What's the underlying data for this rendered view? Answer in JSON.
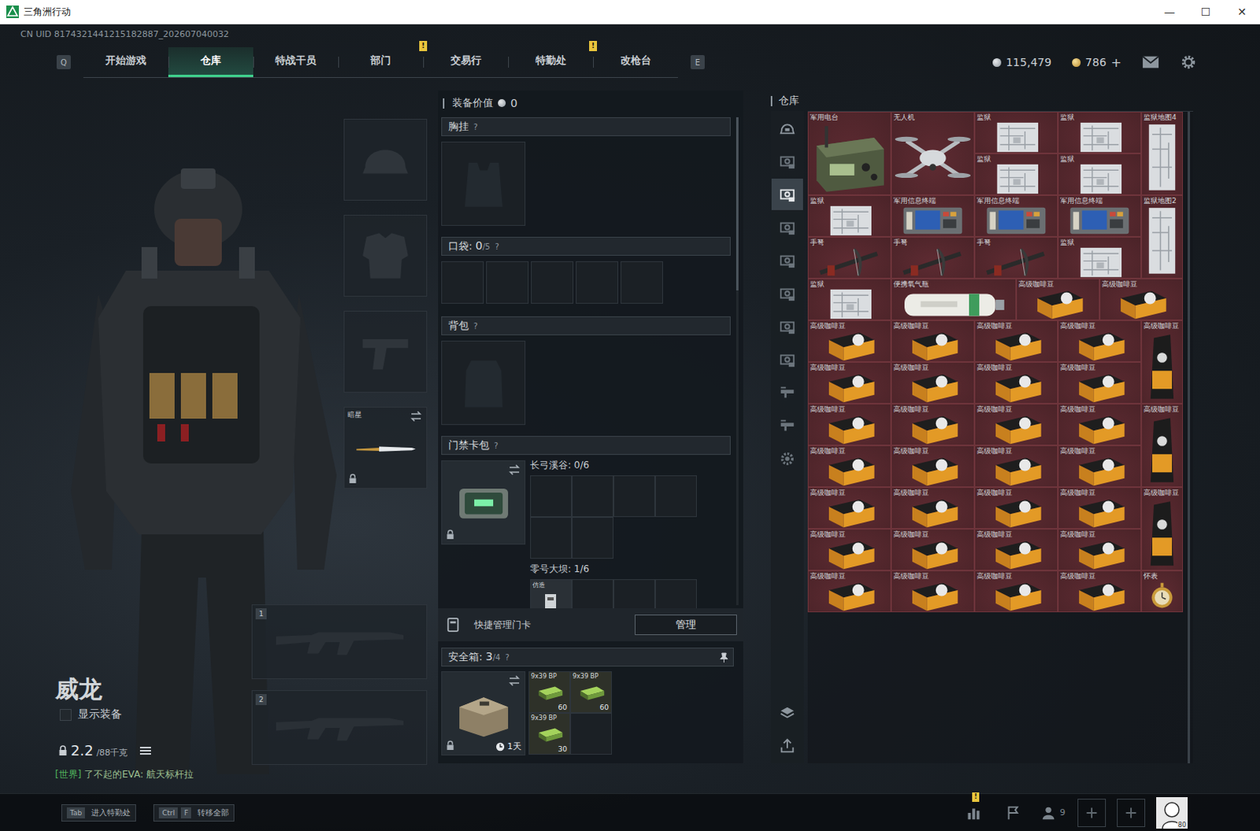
{
  "window": {
    "title": "三角洲行动",
    "controls": [
      "—",
      "☐",
      "✕"
    ]
  },
  "uid": "CN UID 8174321441215182887_202607040032",
  "nav": {
    "prev_key": "Q",
    "next_key": "E",
    "tabs": [
      {
        "label": "开始游戏",
        "selected": false,
        "badge": ""
      },
      {
        "label": "仓库",
        "selected": true,
        "badge": ""
      },
      {
        "label": "特战干员",
        "selected": false,
        "badge": ""
      },
      {
        "label": "部门",
        "selected": false,
        "badge": "!"
      },
      {
        "label": "交易行",
        "selected": false,
        "badge": ""
      },
      {
        "label": "特勤处",
        "selected": false,
        "badge": "!"
      },
      {
        "label": "改枪台",
        "selected": false,
        "badge": ""
      }
    ]
  },
  "wallet": [
    {
      "kind": "coin",
      "value": "115,479",
      "action": ""
    },
    {
      "kind": "gold",
      "value": "786",
      "action": "+"
    }
  ],
  "character": {
    "name": "威龙",
    "show_equipment": {
      "label": "显示装备",
      "checked": false
    },
    "weight": {
      "current": "2.2",
      "max": "/88千克"
    },
    "chat": {
      "channel": "[世界]",
      "message": "了不起的EVA: 航天标杆拉"
    }
  },
  "gear_slots": [
    {
      "kind": "helmet",
      "label": "",
      "locked": false,
      "swappable": false
    },
    {
      "kind": "armor",
      "label": "",
      "locked": false,
      "swappable": false
    },
    {
      "kind": "pistol",
      "label": "",
      "locked": false,
      "swappable": false
    },
    {
      "kind": "melee",
      "label": "暗星",
      "locked": true,
      "swappable": true
    }
  ],
  "weapon_slots": [
    {
      "index": "1"
    },
    {
      "index": "2"
    }
  ],
  "loadout": {
    "value_label": "装备价值",
    "value": "0",
    "chest_rig": {
      "label": "胸挂",
      "help": "?"
    },
    "pockets": {
      "label": "口袋:",
      "used": "0",
      "capacity": "/5",
      "help": "?",
      "slots": [
        {
          "filled": false
        },
        {
          "filled": false
        },
        {
          "filled": false
        },
        {
          "filled": false
        },
        {
          "filled": false
        }
      ]
    },
    "backpack": {
      "label": "背包",
      "help": "?"
    },
    "keycard": {
      "label": "门禁卡包",
      "help": "?",
      "locked": true,
      "swappable": true,
      "maps": [
        {
          "label": "长弓溪谷: 0/6",
          "cells": [
            {
              "item": ""
            },
            {
              "item": ""
            },
            {
              "item": ""
            },
            {
              "item": ""
            },
            {
              "item": ""
            },
            {
              "item": ""
            }
          ]
        },
        {
          "label": "零号大坝: 1/6",
          "cells": [
            {
              "item": "仿造"
            },
            {
              "item": ""
            },
            {
              "item": ""
            },
            {
              "item": ""
            },
            {
              "item": ""
            },
            {
              "item": ""
            }
          ]
        }
      ]
    },
    "quick_manage": {
      "label": "快捷管理门卡",
      "button": "管理"
    },
    "safe_box": {
      "label": "安全箱:",
      "used": "3",
      "capacity": "/4",
      "help": "?",
      "timer": "1天",
      "locked": true,
      "swappable": true,
      "items": [
        {
          "filled": true,
          "label": "9x39 BP",
          "count": "60"
        },
        {
          "filled": true,
          "label": "9x39 BP",
          "count": "60"
        },
        {
          "filled": true,
          "label": "9x39 BP",
          "count": "30"
        },
        {
          "filled": false,
          "label": "",
          "count": ""
        }
      ]
    }
  },
  "warehouse": {
    "title": "仓库",
    "sidebar": [
      {
        "kind": "all",
        "selected": false
      },
      {
        "kind": "stash",
        "selected": false
      },
      {
        "kind": "stash",
        "selected": true
      },
      {
        "kind": "stash",
        "selected": false
      },
      {
        "kind": "stash",
        "selected": false
      },
      {
        "kind": "stash",
        "selected": false
      },
      {
        "kind": "stash",
        "selected": false
      },
      {
        "kind": "stash",
        "selected": false
      },
      {
        "kind": "gti",
        "selected": false
      },
      {
        "kind": "gti",
        "selected": false
      },
      {
        "kind": "settings",
        "selected": false
      }
    ],
    "tools": [
      {
        "kind": "layers"
      },
      {
        "kind": "sort"
      }
    ],
    "items": [
      {
        "name": "军用电台",
        "kind": "radio",
        "w": 2,
        "h": 2
      },
      {
        "name": "无人机",
        "kind": "drone",
        "w": 2,
        "h": 2
      },
      {
        "name": "监狱",
        "kind": "map",
        "w": 2,
        "h": 1
      },
      {
        "name": "监狱",
        "kind": "map",
        "w": 2,
        "h": 1
      },
      {
        "name": "监狱地图4",
        "kind": "map-tall",
        "w": 1,
        "h": 2
      },
      {
        "name": "监狱",
        "kind": "map",
        "w": 2,
        "h": 1
      },
      {
        "name": "监狱",
        "kind": "map",
        "w": 2,
        "h": 1
      },
      {
        "name": "监狱",
        "kind": "map",
        "w": 2,
        "h": 1
      },
      {
        "name": "军用信息终端",
        "kind": "terminal",
        "w": 2,
        "h": 1
      },
      {
        "name": "军用信息终端",
        "kind": "terminal",
        "w": 2,
        "h": 1
      },
      {
        "name": "军用信息终端",
        "kind": "terminal",
        "w": 2,
        "h": 1
      },
      {
        "name": "监狱地图2",
        "kind": "map-tall",
        "w": 1,
        "h": 2
      },
      {
        "name": "手弩",
        "kind": "crossbow",
        "w": 2,
        "h": 1
      },
      {
        "name": "手弩",
        "kind": "crossbow",
        "w": 2,
        "h": 1
      },
      {
        "name": "手弩",
        "kind": "crossbow",
        "w": 2,
        "h": 1
      },
      {
        "name": "监狱",
        "kind": "map",
        "w": 2,
        "h": 1
      },
      {
        "name": "监狱",
        "kind": "map",
        "w": 2,
        "h": 1
      },
      {
        "name": "便携氧气瓶",
        "kind": "oxygen",
        "w": 3,
        "h": 1
      },
      {
        "name": "高级咖啡豆",
        "kind": "coffee",
        "w": 2,
        "h": 1
      },
      {
        "name": "高级咖啡豆",
        "kind": "coffee",
        "w": 2,
        "h": 1
      },
      {
        "name": "高级咖啡豆",
        "kind": "coffee",
        "w": 2,
        "h": 1
      },
      {
        "name": "高级咖啡豆",
        "kind": "coffee",
        "w": 2,
        "h": 1
      },
      {
        "name": "高级咖啡豆",
        "kind": "coffee",
        "w": 2,
        "h": 1
      },
      {
        "name": "高级咖啡豆",
        "kind": "coffee",
        "w": 2,
        "h": 1
      },
      {
        "name": "高级咖啡豆",
        "kind": "coffee-bag",
        "w": 1,
        "h": 2
      },
      {
        "name": "高级咖啡豆",
        "kind": "coffee",
        "w": 2,
        "h": 1
      },
      {
        "name": "高级咖啡豆",
        "kind": "coffee",
        "w": 2,
        "h": 1
      },
      {
        "name": "高级咖啡豆",
        "kind": "coffee",
        "w": 2,
        "h": 1
      },
      {
        "name": "高级咖啡豆",
        "kind": "coffee",
        "w": 2,
        "h": 1
      },
      {
        "name": "高级咖啡豆",
        "kind": "coffee",
        "w": 2,
        "h": 1
      },
      {
        "name": "高级咖啡豆",
        "kind": "coffee",
        "w": 2,
        "h": 1
      },
      {
        "name": "高级咖啡豆",
        "kind": "coffee",
        "w": 2,
        "h": 1
      },
      {
        "name": "高级咖啡豆",
        "kind": "coffee",
        "w": 2,
        "h": 1
      },
      {
        "name": "高级咖啡豆",
        "kind": "coffee-bag",
        "w": 1,
        "h": 2
      },
      {
        "name": "高级咖啡豆",
        "kind": "coffee",
        "w": 2,
        "h": 1
      },
      {
        "name": "高级咖啡豆",
        "kind": "coffee",
        "w": 2,
        "h": 1
      },
      {
        "name": "高级咖啡豆",
        "kind": "coffee",
        "w": 2,
        "h": 1
      },
      {
        "name": "高级咖啡豆",
        "kind": "coffee",
        "w": 2,
        "h": 1
      },
      {
        "name": "高级咖啡豆",
        "kind": "coffee",
        "w": 2,
        "h": 1
      },
      {
        "name": "高级咖啡豆",
        "kind": "coffee",
        "w": 2,
        "h": 1
      },
      {
        "name": "高级咖啡豆",
        "kind": "coffee",
        "w": 2,
        "h": 1
      },
      {
        "name": "高级咖啡豆",
        "kind": "coffee",
        "w": 2,
        "h": 1
      },
      {
        "name": "高级咖啡豆",
        "kind": "coffee-bag",
        "w": 1,
        "h": 2
      },
      {
        "name": "高级咖啡豆",
        "kind": "coffee",
        "w": 2,
        "h": 1
      },
      {
        "name": "高级咖啡豆",
        "kind": "coffee",
        "w": 2,
        "h": 1
      },
      {
        "name": "高级咖啡豆",
        "kind": "coffee",
        "w": 2,
        "h": 1
      },
      {
        "name": "高级咖啡豆",
        "kind": "coffee",
        "w": 2,
        "h": 1
      },
      {
        "name": "高级咖啡豆",
        "kind": "coffee",
        "w": 2,
        "h": 1
      },
      {
        "name": "高级咖啡豆",
        "kind": "coffee",
        "w": 2,
        "h": 1
      },
      {
        "name": "高级咖啡豆",
        "kind": "coffee",
        "w": 2,
        "h": 1
      },
      {
        "name": "高级咖啡豆",
        "kind": "coffee",
        "w": 2,
        "h": 1
      },
      {
        "name": "怀表",
        "kind": "watch",
        "w": 1,
        "h": 1
      }
    ]
  },
  "bottom": {
    "hints": [
      {
        "keys": [
          "Tab"
        ],
        "label": "进入特勤处"
      },
      {
        "keys": [
          "Ctrl",
          "F"
        ],
        "label": "转移全部"
      }
    ],
    "tray": [
      {
        "kind": "stats",
        "badge": "!",
        "count": ""
      },
      {
        "kind": "flag",
        "badge": "",
        "count": ""
      },
      {
        "kind": "friends",
        "badge": "",
        "count": "9"
      },
      {
        "kind": "add",
        "badge": "",
        "count": ""
      },
      {
        "kind": "add",
        "badge": "",
        "count": ""
      },
      {
        "kind": "avatar",
        "badge": "",
        "count": "80"
      }
    ]
  }
}
